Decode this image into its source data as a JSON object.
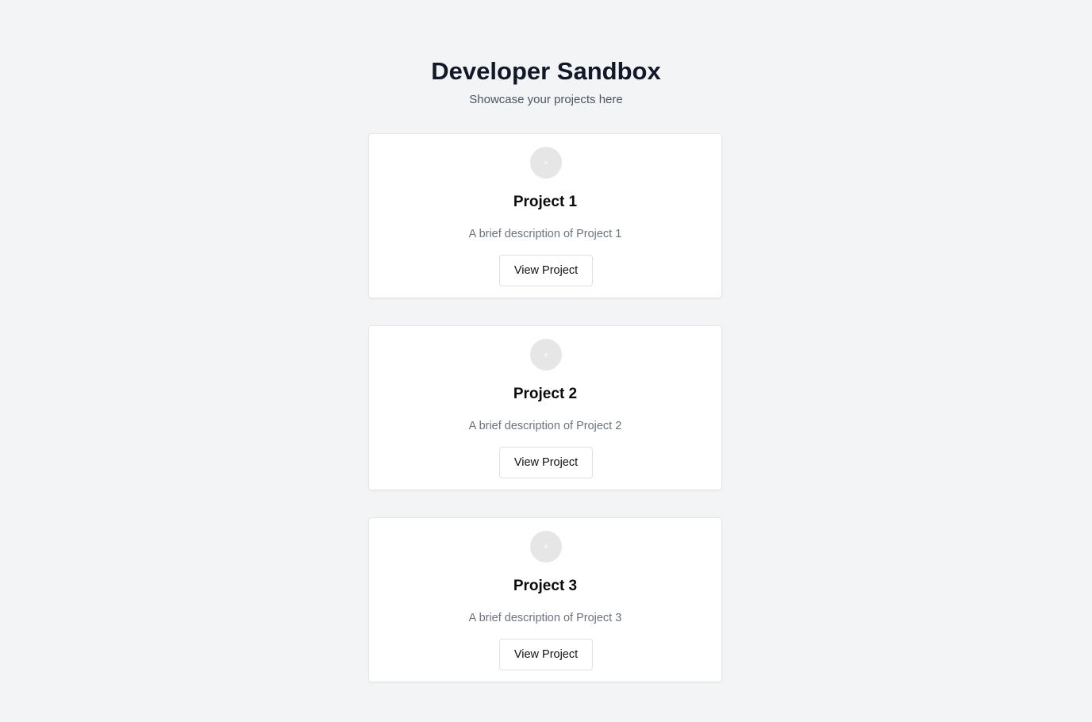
{
  "header": {
    "title": "Developer Sandbox",
    "subtitle": "Showcase your projects here"
  },
  "projects": [
    {
      "title": "Project 1",
      "description": "A brief description of Project 1",
      "button_label": "View Project",
      "icon": "image-placeholder-icon"
    },
    {
      "title": "Project 2",
      "description": "A brief description of Project 2",
      "button_label": "View Project",
      "icon": "image-placeholder-icon"
    },
    {
      "title": "Project 3",
      "description": "A brief description of Project 3",
      "button_label": "View Project",
      "icon": "image-placeholder-icon"
    }
  ],
  "colors": {
    "background": "#f2f4f6",
    "card": "#ffffff",
    "title": "#111827",
    "muted": "#6b7280"
  }
}
